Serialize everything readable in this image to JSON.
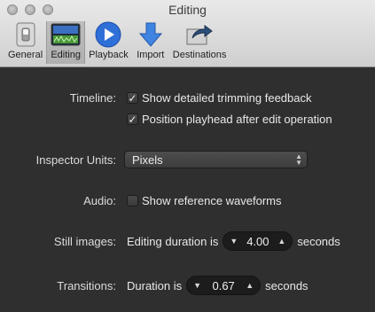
{
  "window": {
    "title": "Editing"
  },
  "toolbar": {
    "items": [
      {
        "label": "General",
        "icon": "switch-icon"
      },
      {
        "label": "Editing",
        "icon": "filmstrip-icon",
        "selected": true
      },
      {
        "label": "Playback",
        "icon": "play-icon"
      },
      {
        "label": "Import",
        "icon": "download-arrow-icon"
      },
      {
        "label": "Destinations",
        "icon": "share-icon"
      }
    ]
  },
  "timeline": {
    "label": "Timeline:",
    "option1": {
      "label": "Show detailed trimming feedback",
      "checked": true
    },
    "option2": {
      "label": "Position playhead after edit operation",
      "checked": true
    }
  },
  "inspector_units": {
    "label": "Inspector Units:",
    "value": "Pixels"
  },
  "audio": {
    "label": "Audio:",
    "option": {
      "label": "Show reference waveforms",
      "checked": false
    }
  },
  "still_images": {
    "label": "Still images:",
    "prefix": "Editing duration is",
    "value": "4.00",
    "suffix": "seconds"
  },
  "transitions": {
    "label": "Transitions:",
    "prefix": "Duration is",
    "value": "0.67",
    "suffix": "seconds"
  },
  "glyphs": {
    "check": "✓",
    "up": "▲",
    "down": "▼"
  },
  "colors": {
    "accent": "#2f6fd8",
    "background": "#2f2f2f"
  }
}
